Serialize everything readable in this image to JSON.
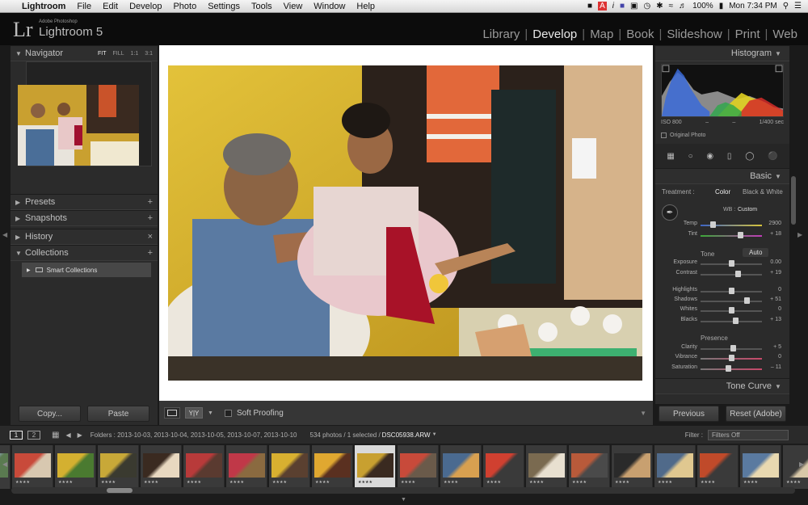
{
  "menubar": {
    "apple": "",
    "items": [
      "Lightroom",
      "File",
      "Edit",
      "Develop",
      "Photo",
      "Settings",
      "Tools",
      "View",
      "Window",
      "Help"
    ],
    "battery": "100%",
    "clock": "Mon 7:34 PM"
  },
  "identity": {
    "logo": "Lr",
    "brand_small": "Adobe Photoshop",
    "app_name": "Lightroom 5"
  },
  "modules": [
    "Library",
    "Develop",
    "Map",
    "Book",
    "Slideshow",
    "Print",
    "Web"
  ],
  "active_module": "Develop",
  "left_panel": {
    "navigator": {
      "title": "Navigator",
      "zoom": [
        "FIT",
        "FILL",
        "1:1",
        "3:1"
      ]
    },
    "presets": "Presets",
    "snapshots": "Snapshots",
    "history": "History",
    "collections": "Collections",
    "smart_collections": "Smart Collections",
    "copy_button": "Copy...",
    "paste_button": "Paste"
  },
  "toolbar": {
    "soft_proofing": "Soft Proofing"
  },
  "right_panel": {
    "histogram_title": "Histogram",
    "iso": "ISO 800",
    "dash1": "–",
    "dash2": "–",
    "shutter": "1/400 sec",
    "original_photo": "Original Photo",
    "basic_title": "Basic",
    "treatment_label": "Treatment :",
    "treatment_color": "Color",
    "treatment_bw": "Black & White",
    "wb_label": "WB :",
    "wb_value": "Custom",
    "tone_label": "Tone",
    "auto_label": "Auto",
    "presence_label": "Presence",
    "tone_curve_title": "Tone Curve",
    "previous_button": "Previous",
    "reset_button": "Reset (Adobe)",
    "sliders": [
      {
        "label": "Temp",
        "value": "2900",
        "pos": 0.2
      },
      {
        "label": "Tint",
        "value": "+ 18",
        "pos": 0.65
      },
      {
        "label": "Exposure",
        "value": "0.00",
        "pos": 0.5
      },
      {
        "label": "Contrast",
        "value": "+ 19",
        "pos": 0.6
      },
      {
        "label": "Highlights",
        "value": "0",
        "pos": 0.5
      },
      {
        "label": "Shadows",
        "value": "+ 51",
        "pos": 0.75
      },
      {
        "label": "Whites",
        "value": "0",
        "pos": 0.5
      },
      {
        "label": "Blacks",
        "value": "+ 13",
        "pos": 0.56
      },
      {
        "label": "Clarity",
        "value": "+ 5",
        "pos": 0.52
      },
      {
        "label": "Vibrance",
        "value": "0",
        "pos": 0.5
      },
      {
        "label": "Saturation",
        "value": "– 11",
        "pos": 0.45
      }
    ]
  },
  "filmstrip": {
    "page1": "1",
    "page2": "2",
    "folders": "Folders : 2013-10-03, 2013-10-04, 2013-10-05, 2013-10-07, 2013-10-10",
    "count": "534 photos / 1 selected /",
    "filename": "DSC05938.ARW",
    "filter_label": "Filter :",
    "filter_value": "Filters Off",
    "stars": "★★★★",
    "selected_index": 9
  },
  "colors": {
    "accent": "#e0e0e0",
    "panel": "#2b2b2b",
    "photo_wall": "#d8b531"
  }
}
